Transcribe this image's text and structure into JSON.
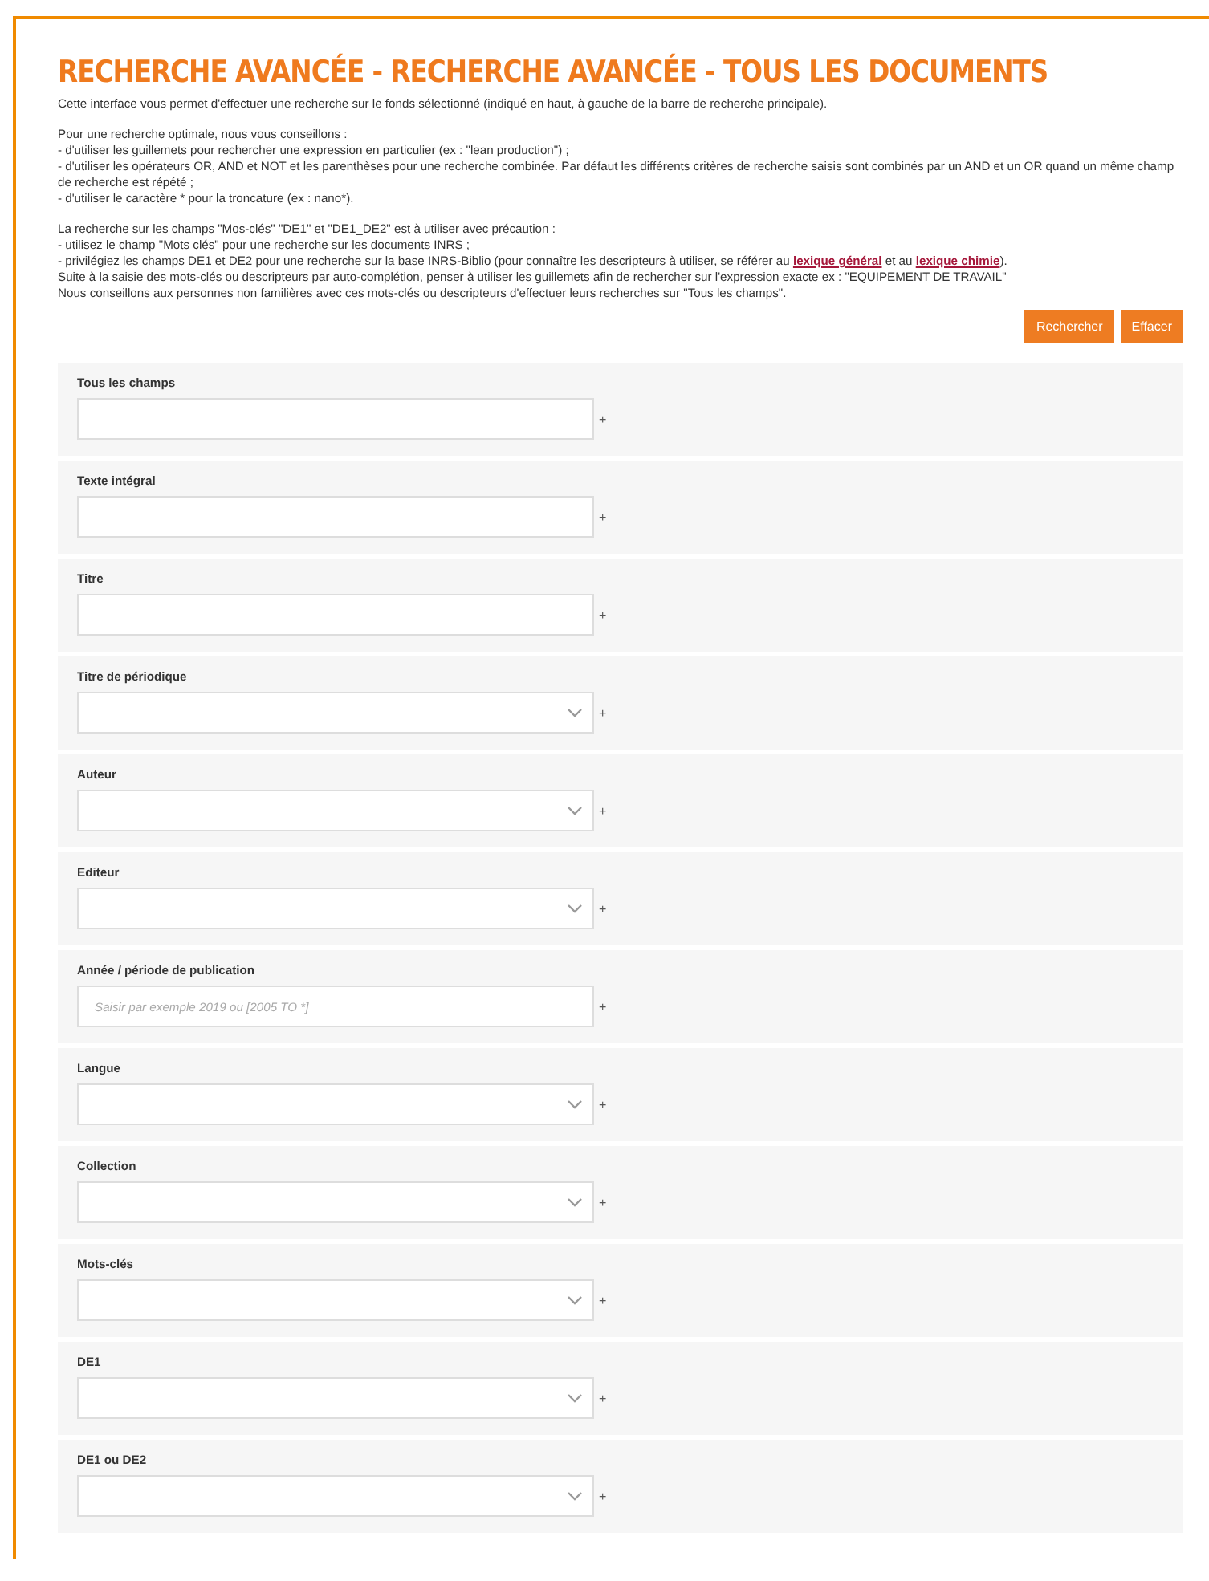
{
  "title": "RECHERCHE AVANCÉE - RECHERCHE AVANCÉE - TOUS LES DOCUMENTS",
  "intro": [
    [
      [
        {
          "kind": "text",
          "text": "Cette interface vous permet d'effectuer une recherche sur le fonds sélectionné (indiqué en haut, à gauche de la barre de recherche principale)."
        }
      ]
    ],
    [
      [
        {
          "kind": "text",
          "text": "Pour une recherche optimale, nous vous conseillons :"
        }
      ],
      [
        {
          "kind": "text",
          "text": "- d'utiliser les guillemets pour rechercher une expression en particulier (ex : \"lean production\") ;"
        }
      ],
      [
        {
          "kind": "text",
          "text": "- d'utiliser les opérateurs OR, AND et NOT et les parenthèses pour une recherche combinée. Par défaut les différents critères de recherche saisis sont combinés par un AND et un OR quand un même champ de recherche est répété ;"
        }
      ],
      [
        {
          "kind": "text",
          "text": "- d'utiliser le caractère * pour la troncature (ex : nano*)."
        }
      ]
    ],
    [
      [
        {
          "kind": "text",
          "text": "La recherche sur les champs \"Mos-clés\" \"DE1\" et \"DE1_DE2\" est à utiliser avec précaution :"
        }
      ],
      [
        {
          "kind": "text",
          "text": "- utilisez le champ \"Mots clés\" pour une recherche sur les documents INRS ;"
        }
      ],
      [
        {
          "kind": "text",
          "text": "- privilégiez les champs DE1 et DE2 pour une recherche sur la base INRS-Biblio (pour connaître les descripteurs à utiliser, se référer au "
        },
        {
          "kind": "link",
          "text": "lexique général"
        },
        {
          "kind": "text",
          "text": " et au "
        },
        {
          "kind": "link",
          "text": "lexique chimie"
        },
        {
          "kind": "text",
          "text": ")."
        }
      ],
      [
        {
          "kind": "text",
          "text": "Suite à la saisie des mots-clés ou descripteurs par auto-complétion, penser à utiliser les guillemets afin de rechercher sur l'expression exacte ex : \"EQUIPEMENT DE TRAVAIL\""
        }
      ],
      [
        {
          "kind": "text",
          "text": "Nous conseillons aux personnes non familières avec ces mots-clés ou descripteurs d'effectuer leurs recherches sur \"Tous les champs\"."
        }
      ]
    ]
  ],
  "buttons": [
    "Rechercher",
    "Effacer"
  ],
  "fields": [
    {
      "label": "Tous les champs",
      "kind": "text"
    },
    {
      "label": "Texte intégral",
      "kind": "text"
    },
    {
      "label": "Titre",
      "kind": "text"
    },
    {
      "label": "Titre de périodique",
      "kind": "select"
    },
    {
      "label": "Auteur",
      "kind": "select"
    },
    {
      "label": "Editeur",
      "kind": "select"
    },
    {
      "label": "Année / période de publication",
      "kind": "text",
      "placeholder": "Saisir par exemple 2019 ou [2005 TO *]"
    },
    {
      "label": "Langue",
      "kind": "select"
    },
    {
      "label": "Collection",
      "kind": "select"
    },
    {
      "label": "Mots-clés",
      "kind": "select"
    },
    {
      "label": "DE1",
      "kind": "select"
    },
    {
      "label": "DE1 ou DE2",
      "kind": "select"
    }
  ],
  "add_mark": "+"
}
